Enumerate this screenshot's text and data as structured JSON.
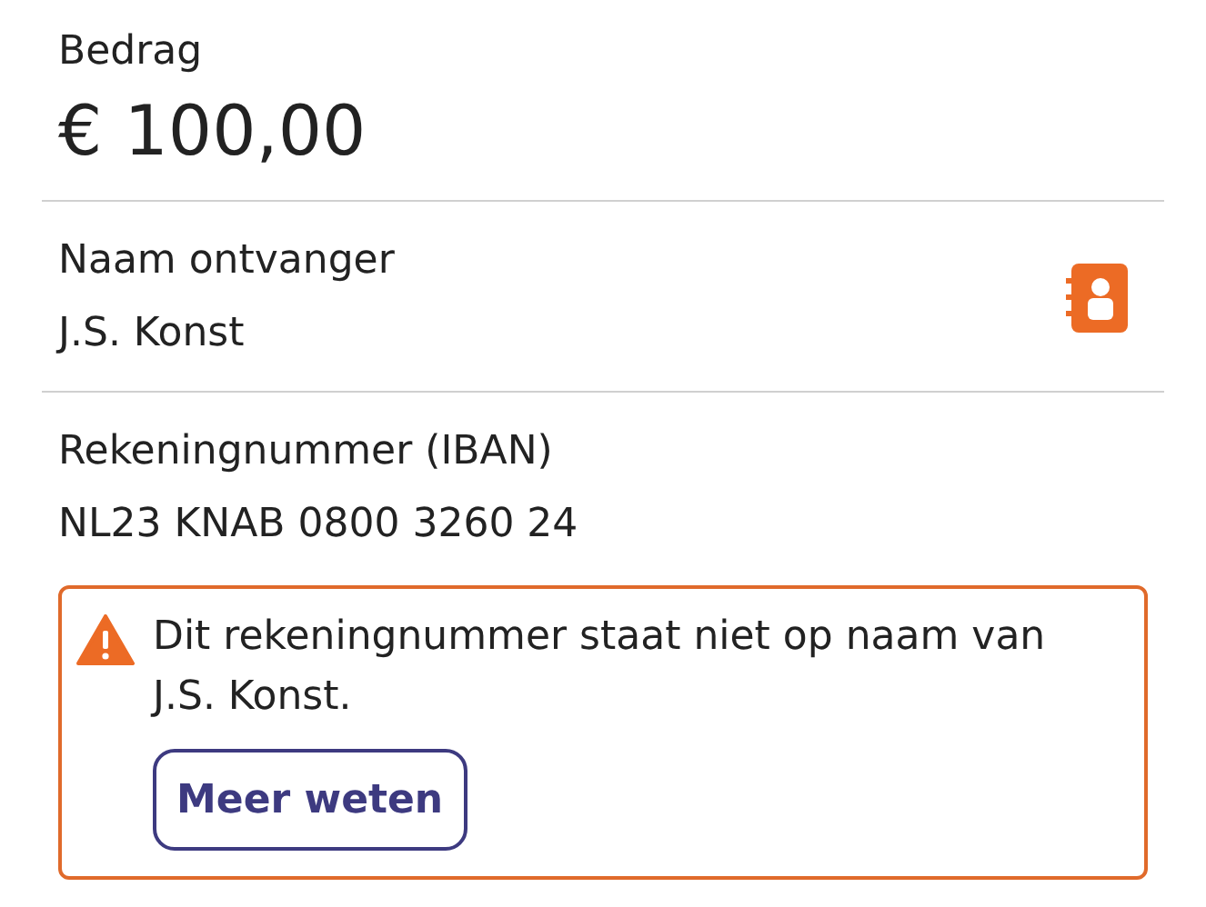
{
  "amount": {
    "label": "Bedrag",
    "value": "€ 100,00"
  },
  "recipient": {
    "label": "Naam ontvanger",
    "value": "J.S. Konst"
  },
  "iban": {
    "label": "Rekeningnummer (IBAN)",
    "value": "NL23 KNAB 0800 3260 24"
  },
  "warning": {
    "message": "Dit rekeningnummer staat niet op naam van J.S. Konst.",
    "button": "Meer weten"
  }
}
